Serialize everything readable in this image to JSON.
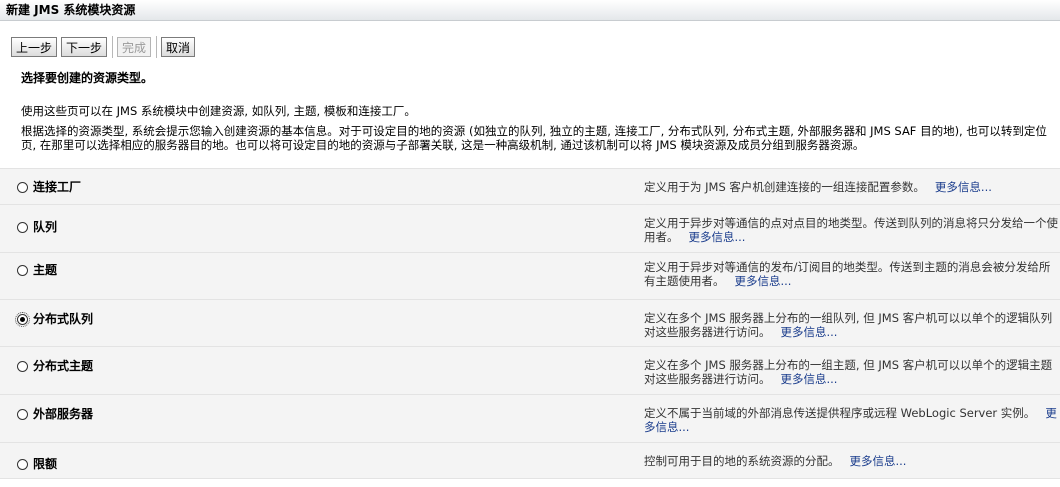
{
  "window": {
    "title": "新建 JMS 系统模块资源"
  },
  "toolbar": {
    "back_label": "上一步",
    "next_label": "下一步",
    "finish_label": "完成",
    "cancel_label": "取消"
  },
  "page": {
    "heading": "选择要创建的资源类型。",
    "intro": "使用这些页可以在 JMS 系统模块中创建资源, 如队列, 主题, 模板和连接工厂。",
    "detail": "根据选择的资源类型, 系统会提示您输入创建资源的基本信息。对于可设定目的地的资源 (如独立的队列, 独立的主题, 连接工厂, 分布式队列, 分布式主题, 外部服务器和 JMS SAF 目的地), 也可以转到定位页, 在那里可以选择相应的服务器目的地。也可以将可设定目的地的资源与子部署关联, 这是一种高级机制, 通过该机制可以将 JMS 模块资源及成员分组到服务器资源。"
  },
  "resource_types": [
    {
      "label": "连接工厂",
      "description": "定义用于为 JMS 客户机创建连接的一组连接配置参数。",
      "more": "更多信息...",
      "selected": false
    },
    {
      "label": "队列",
      "description": "定义用于异步对等通信的点对点目的地类型。传送到队列的消息将只分发给一个使用者。",
      "more": "更多信息...",
      "selected": false
    },
    {
      "label": "主题",
      "description": "定义用于异步对等通信的发布/订阅目的地类型。传送到主题的消息会被分发给所有主题使用者。",
      "more": "更多信息...",
      "selected": false
    },
    {
      "label": "分布式队列",
      "description": "定义在多个 JMS 服务器上分布的一组队列, 但 JMS 客户机可以以单个的逻辑队列对这些服务器进行访问。",
      "more": "更多信息...",
      "selected": true
    },
    {
      "label": "分布式主题",
      "description": "定义在多个 JMS 服务器上分布的一组主题, 但 JMS 客户机可以以单个的逻辑主题对这些服务器进行访问。",
      "more": "更多信息...",
      "selected": false
    },
    {
      "label": "外部服务器",
      "description": "定义不属于当前域的外部消息传送提供程序或远程 WebLogic Server 实例。",
      "more": "更多信息...",
      "selected": false
    },
    {
      "label": "限额",
      "description": "控制可用于目的地的系统资源的分配。",
      "more": "更多信息...",
      "selected": false
    }
  ]
}
